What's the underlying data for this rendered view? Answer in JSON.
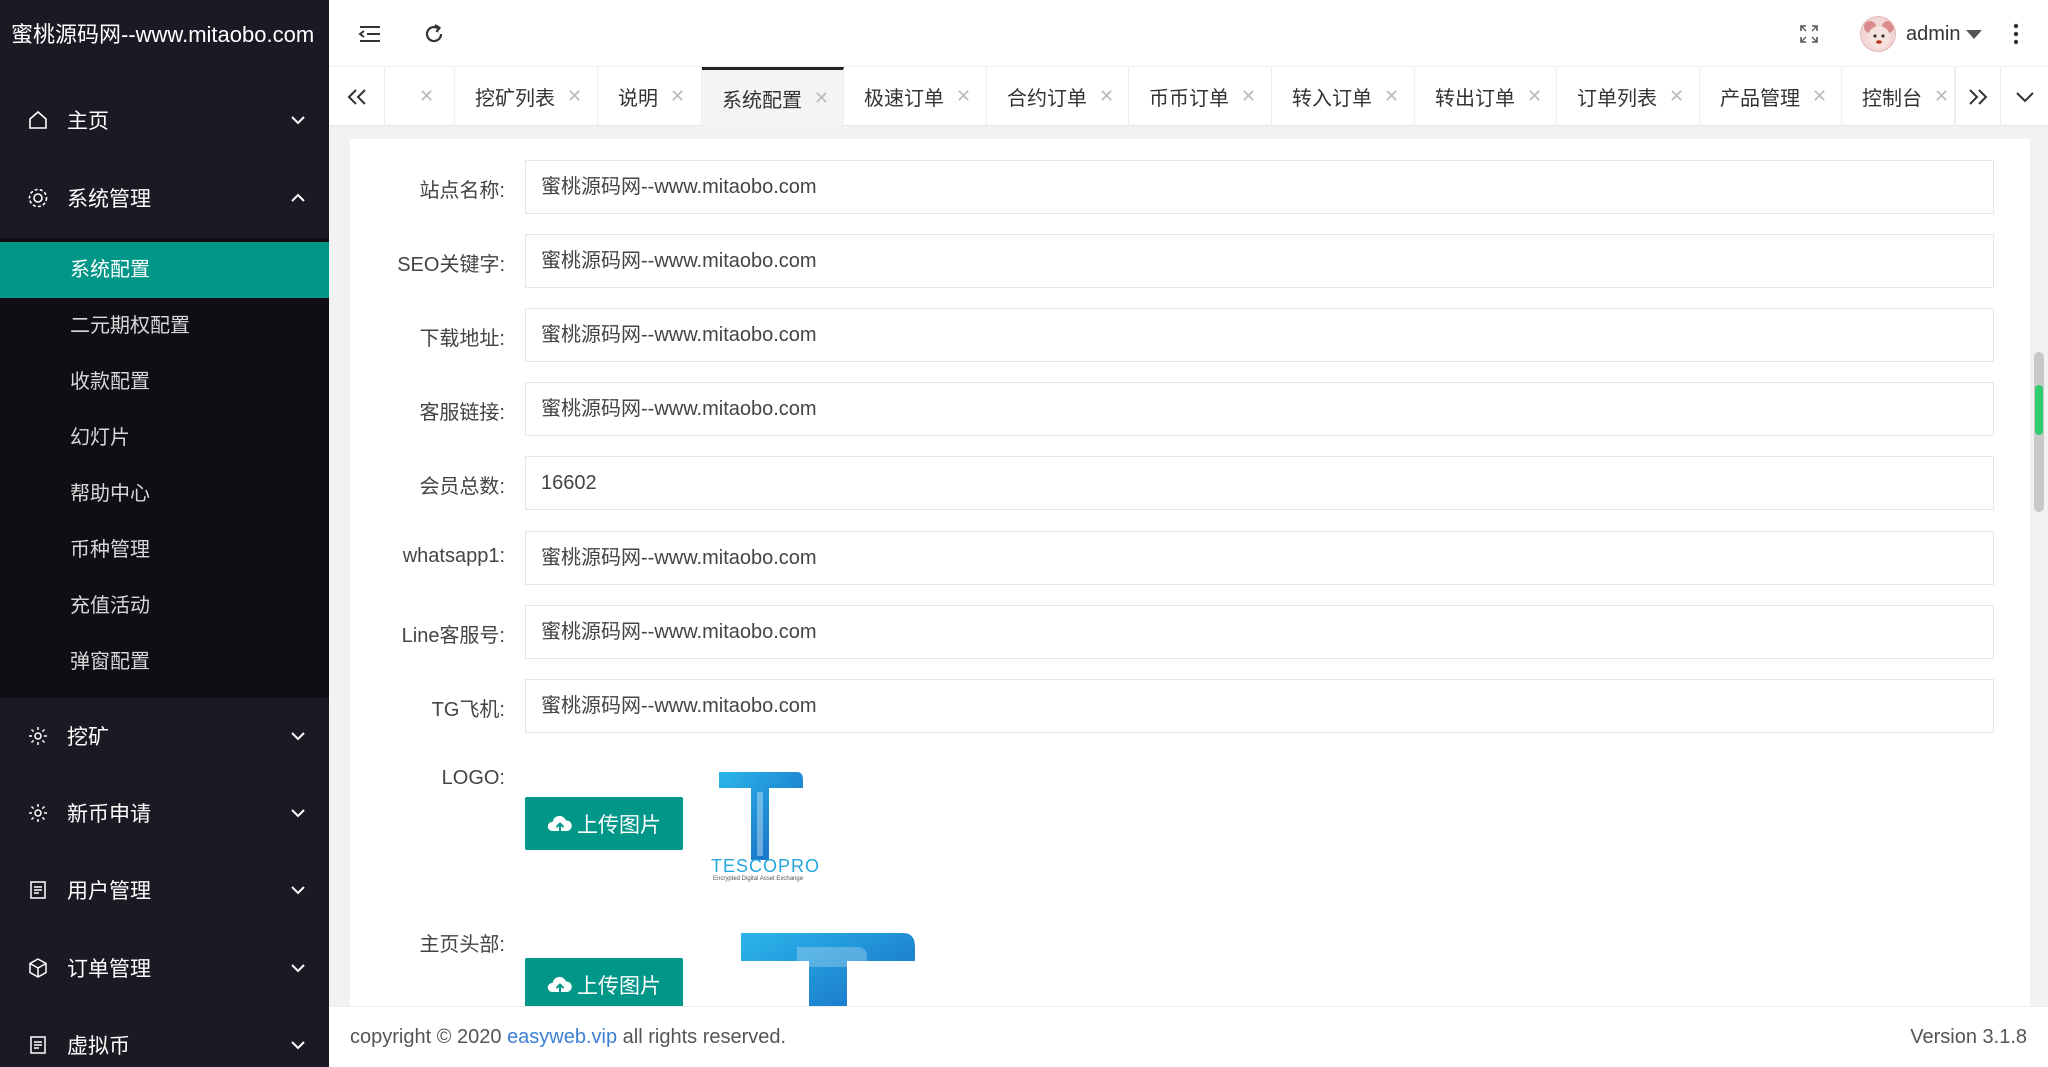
{
  "brand": {
    "title": "蜜桃源码网--www.mitaobo.com"
  },
  "sidebar": {
    "menu": [
      {
        "label": "主页",
        "icon": "home-icon"
      },
      {
        "label": "系统管理",
        "icon": "gear-icon"
      },
      {
        "label": "挖矿",
        "icon": "settings-icon"
      },
      {
        "label": "新币申请",
        "icon": "settings-icon"
      },
      {
        "label": "用户管理",
        "icon": "document-icon"
      },
      {
        "label": "订单管理",
        "icon": "cube-icon"
      },
      {
        "label": "虚拟币",
        "icon": "document-icon"
      }
    ],
    "submenu": [
      "系统配置",
      "二元期权配置",
      "收款配置",
      "幻灯片",
      "帮助中心",
      "币种管理",
      "充值活动",
      "弹窗配置"
    ],
    "active_submenu": "系统配置"
  },
  "header": {
    "username": "admin"
  },
  "tabs": [
    {
      "label": ""
    },
    {
      "label": "挖矿列表"
    },
    {
      "label": "说明"
    },
    {
      "label": "系统配置"
    },
    {
      "label": "极速订单"
    },
    {
      "label": "合约订单"
    },
    {
      "label": "币币订单"
    },
    {
      "label": "转入订单"
    },
    {
      "label": "转出订单"
    },
    {
      "label": "订单列表"
    },
    {
      "label": "产品管理"
    },
    {
      "label": "控制台"
    }
  ],
  "form": {
    "fields": [
      {
        "label": "站点名称:",
        "value": "蜜桃源码网--www.mitaobo.com"
      },
      {
        "label": "SEO关键字:",
        "value": "蜜桃源码网--www.mitaobo.com"
      },
      {
        "label": "下载地址:",
        "value": "蜜桃源码网--www.mitaobo.com"
      },
      {
        "label": "客服链接:",
        "value": "蜜桃源码网--www.mitaobo.com"
      },
      {
        "label": "会员总数:",
        "value": "16602"
      },
      {
        "label": "whatsapp1:",
        "value": "蜜桃源码网--www.mitaobo.com"
      },
      {
        "label": "Line客服号:",
        "value": "蜜桃源码网--www.mitaobo.com"
      },
      {
        "label": "TG飞机:",
        "value": "蜜桃源码网--www.mitaobo.com"
      }
    ],
    "logo": {
      "label": "LOGO:",
      "upload_label": "上传图片",
      "logo_text": "TESCOPRO",
      "logo_subtext": "Encrypted Digital Asset Exchange"
    },
    "header_image": {
      "label": "主页头部:",
      "upload_label": "上传图片"
    }
  },
  "footer": {
    "copyright_prefix": "copyright © 2020 ",
    "link_text": "easyweb.vip",
    "copyright_suffix": " all rights reserved.",
    "version": "Version 3.1.8"
  },
  "colors": {
    "accent": "#009688",
    "sidebar_bg": "#191a23",
    "submenu_bg": "#0e0f14",
    "link": "#3d7fd6"
  }
}
